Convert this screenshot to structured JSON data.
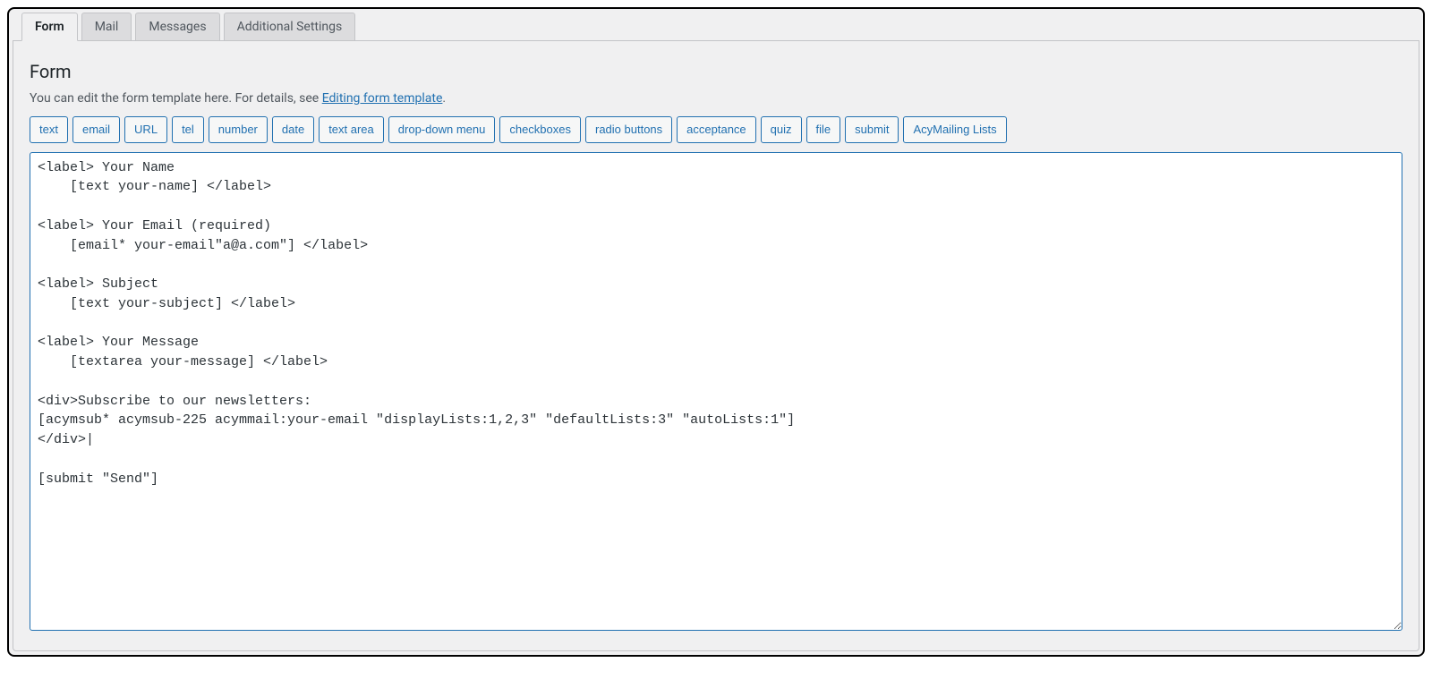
{
  "tabs": {
    "form": "Form",
    "mail": "Mail",
    "messages": "Messages",
    "additional": "Additional Settings"
  },
  "panel": {
    "title": "Form",
    "description_prefix": "You can edit the form template here. For details, see ",
    "description_link": "Editing form template",
    "description_suffix": "."
  },
  "tags": {
    "text": "text",
    "email": "email",
    "url": "URL",
    "tel": "tel",
    "number": "number",
    "date": "date",
    "textarea": "text area",
    "dropdown": "drop-down menu",
    "checkboxes": "checkboxes",
    "radio": "radio buttons",
    "acceptance": "acceptance",
    "quiz": "quiz",
    "file": "file",
    "submit": "submit",
    "acymailing": "AcyMailing Lists"
  },
  "editor": {
    "content": "<label> Your Name\n    [text your-name] </label>\n\n<label> Your Email (required)\n    [email* your-email\"a@a.com\"] </label>\n\n<label> Subject\n    [text your-subject] </label>\n\n<label> Your Message\n    [textarea your-message] </label>\n\n<div>Subscribe to our newsletters:\n[acymsub* acymsub-225 acymmail:your-email \"displayLists:1,2,3\" \"defaultLists:3\" \"autoLists:1\"]\n</div>|\n\n[submit \"Send\"]"
  }
}
